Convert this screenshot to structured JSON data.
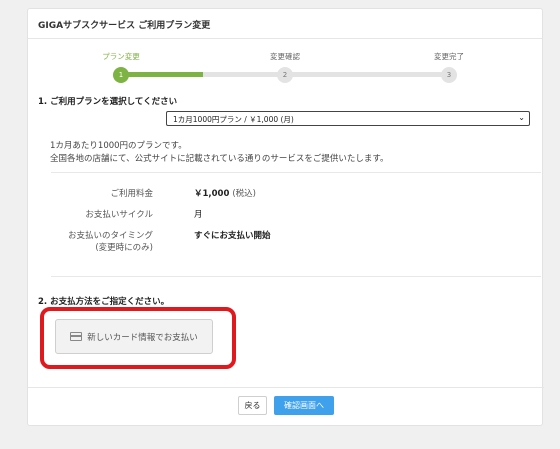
{
  "header": {
    "title": "GIGAサブスクサービス ご利用プラン変更"
  },
  "steps": [
    {
      "label": "プラン変更",
      "number": "1",
      "active": true
    },
    {
      "label": "変更確認",
      "number": "2",
      "active": false
    },
    {
      "label": "変更完了",
      "number": "3",
      "active": false
    }
  ],
  "section1": {
    "title": "1. ご利用プランを選択してください",
    "selected_plan": "1カ月1000円プラン / ￥1,000 (月)",
    "description_line1": "1カ月あたり1000円のプランです。",
    "description_line2": "全国各地の店舗にて、公式サイトに記載されている通りのサービスをご提供いたします。"
  },
  "details": {
    "fee_label": "ご利用料金",
    "fee_value": "￥1,000",
    "fee_note": "(税込)",
    "cycle_label": "お支払いサイクル",
    "cycle_value": "月",
    "timing_label": "お支払いのタイミング",
    "timing_sublabel": "(変更時にのみ)",
    "timing_value": "すぐにお支払い開始"
  },
  "section2": {
    "title": "2. お支払方法をご指定ください。",
    "card_button": "新しいカード情報でお支払い"
  },
  "footer": {
    "back_label": "戻る",
    "confirm_label": "確認画面へ"
  },
  "colors": {
    "accent_green": "#7cb342",
    "primary_blue": "#3fa0ec",
    "highlight_red": "#e0191f"
  },
  "icons": {
    "card": "credit-card-icon"
  }
}
